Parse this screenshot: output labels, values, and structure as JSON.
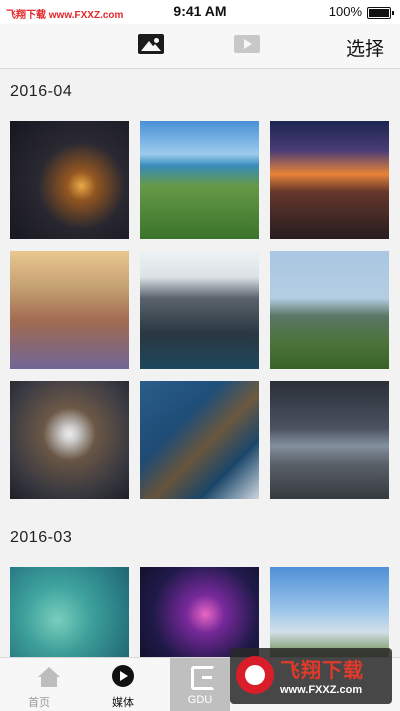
{
  "status_bar": {
    "watermark_text": "飞翔下载 www.FXXZ.com",
    "time": "9:41 AM",
    "battery": "100%"
  },
  "nav_bar": {
    "photo_icon": "photo-icon",
    "video_icon": "video-icon",
    "select_label": "选择"
  },
  "sections": [
    {
      "date": "2016-04"
    },
    {
      "date": "2016-03"
    }
  ],
  "tab_bar": {
    "items": [
      {
        "label": "首页",
        "icon": "home-icon",
        "active": false
      },
      {
        "label": "媒体",
        "icon": "play-circle-icon",
        "active": true
      },
      {
        "label": "GDU",
        "icon": "gdu-logo-icon",
        "active": false
      }
    ]
  },
  "watermark": {
    "title": "飞翔下载",
    "url": "www.FXXZ.com"
  },
  "colors": {
    "watermark_red": "#e3262a",
    "nav_background": "#f7f7f7",
    "content_background": "#f2f2f2"
  }
}
